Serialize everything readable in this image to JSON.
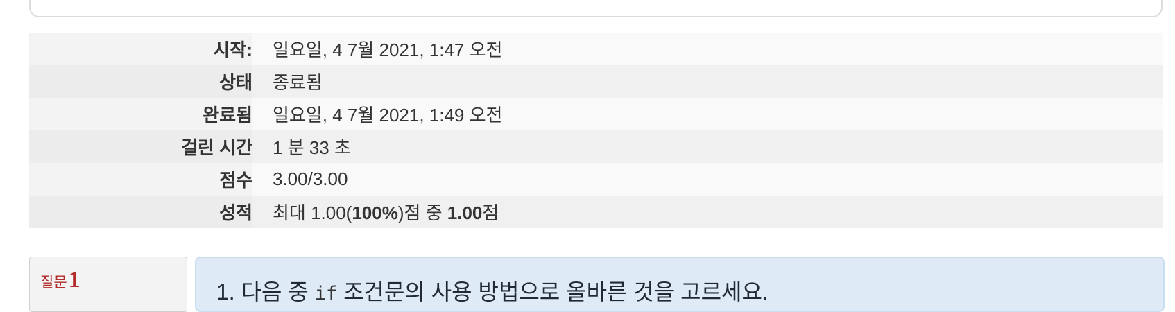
{
  "summary": {
    "rows": [
      {
        "label": "시작:",
        "value": "일요일, 4 7월 2021, 1:47 오전"
      },
      {
        "label": "상태",
        "value": "종료됨"
      },
      {
        "label": "완료됨",
        "value": "일요일, 4 7월 2021, 1:49 오전"
      },
      {
        "label": "걸린 시간",
        "value": "1 분 33 초"
      },
      {
        "label": "점수",
        "value": "3.00/3.00"
      },
      {
        "label": "성적",
        "value_prefix": "최대 1.00(",
        "value_percent": "100%",
        "value_mid": ")점 중 ",
        "value_grade": "1.00",
        "value_suffix": "점"
      }
    ]
  },
  "question": {
    "word": "질문",
    "number": "1",
    "text_before": "1. 다음 중 ",
    "code": "if",
    "text_after": " 조건문의 사용 방법으로 올바른 것을 고르세요."
  },
  "colors": {
    "question_label": "#b32a2a",
    "question_box_bg": "#deebf6",
    "row_odd": "#f9f9f9",
    "row_even": "#f0f0f0"
  }
}
